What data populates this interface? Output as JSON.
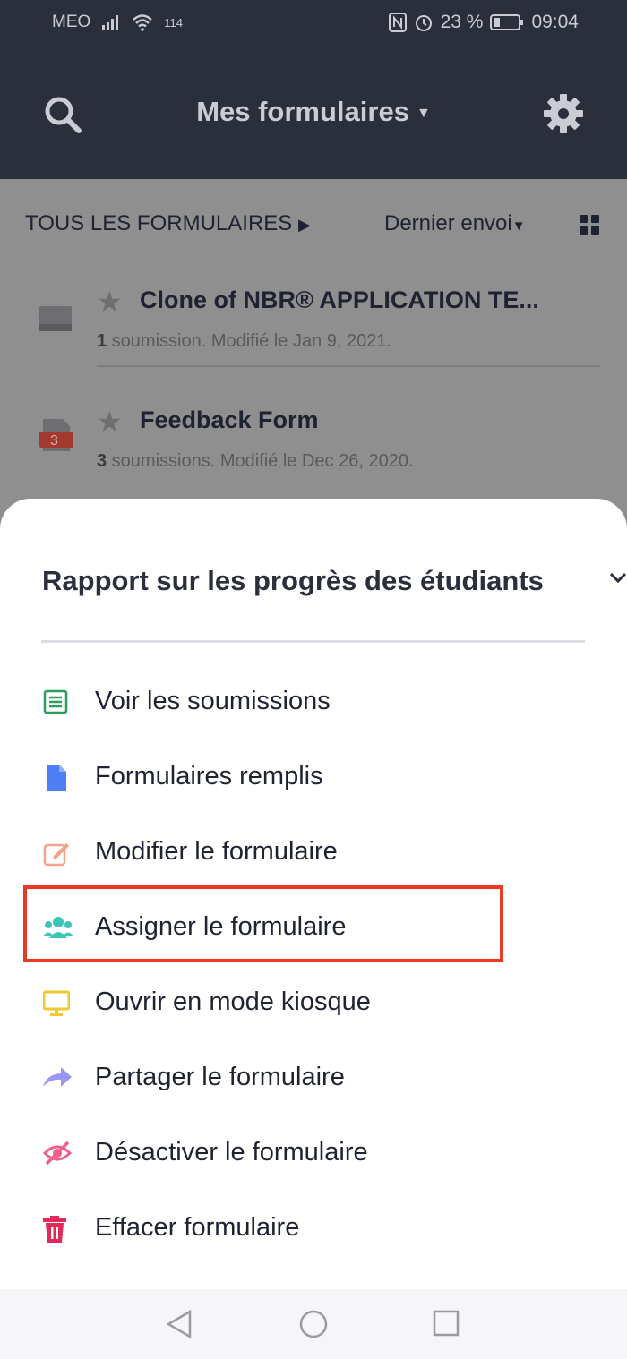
{
  "status_bar": {
    "carrier": "MEO",
    "network_speed": "114",
    "battery_percent": "23 %",
    "time": "09:04"
  },
  "header": {
    "title": "Mes formulaires",
    "icons": [
      "search-icon",
      "gear-icon",
      "chevron-down-icon"
    ]
  },
  "filter_bar": {
    "all_forms_label": "TOUS LES FORMULAIRES",
    "sort_label": "Dernier envoi"
  },
  "forms": [
    {
      "name": "Clone of NBR® APPLICATION TE...",
      "count": "1",
      "meta": " soumission. Modifié le Jan 9, 2021."
    },
    {
      "name": "Feedback Form",
      "count": "3",
      "badge": "3",
      "meta": " soumissions. Modifié le Dec 26, 2020."
    }
  ],
  "sheet": {
    "title": "Rapport sur les progrès des étudiants",
    "items": [
      {
        "label": "Voir les soumissions",
        "icon": "table-icon",
        "color": "#2a9d5c"
      },
      {
        "label": "Formulaires remplis",
        "icon": "document-icon",
        "color": "#4d7ef2"
      },
      {
        "label": "Modifier le formulaire",
        "icon": "edit-icon",
        "color": "#f0a58a"
      },
      {
        "label": "Assigner le formulaire",
        "icon": "users-icon",
        "color": "#3cc6b6"
      },
      {
        "label": "Ouvrir en mode kiosque",
        "icon": "monitor-icon",
        "color": "#f2c92e"
      },
      {
        "label": "Partager le formulaire",
        "icon": "share-icon",
        "color": "#9b95f2"
      },
      {
        "label": "Désactiver le formulaire",
        "icon": "eye-off-icon",
        "color": "#f0608a"
      },
      {
        "label": "Effacer formulaire",
        "icon": "trash-icon",
        "color": "#e02a5a"
      }
    ],
    "highlight_color": "#e83a22"
  },
  "colors": {
    "header_bg": "#2b2f3c",
    "overlay_bg": "#8f8f8f"
  }
}
